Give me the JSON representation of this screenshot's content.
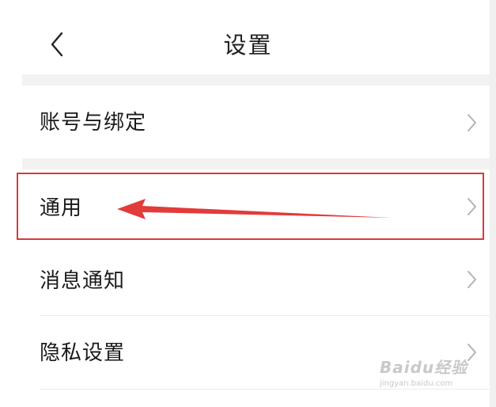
{
  "header": {
    "title": "设置",
    "back_icon": "chevron-left-icon"
  },
  "settings": {
    "items": [
      {
        "label": "账号与绑定",
        "icon": "chevron-right-icon"
      },
      {
        "label": "通用",
        "icon": "chevron-right-icon"
      },
      {
        "label": "消息通知",
        "icon": "chevron-right-icon"
      },
      {
        "label": "隐私设置",
        "icon": "chevron-right-icon"
      }
    ]
  },
  "annotation": {
    "color": "#d93a3a",
    "highlighted_item": "通用"
  },
  "watermark": {
    "brand": "Baidu经验",
    "url": "jingyan.baidu.com"
  },
  "colors": {
    "background": "#ffffff",
    "section_gap": "#f2f2f2",
    "chevron": "#b3b3b3",
    "text": "#1a1a1a"
  }
}
